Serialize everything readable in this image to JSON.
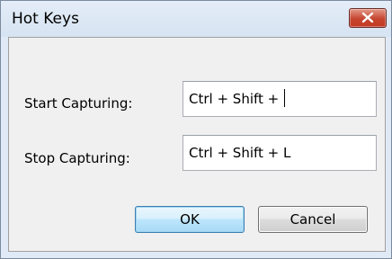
{
  "window": {
    "title": "Hot Keys"
  },
  "form": {
    "start_label": "Start Capturing:",
    "start_value": "Ctrl + Shift + ",
    "stop_label": "Stop Capturing:",
    "stop_value": "Ctrl + Shift + L"
  },
  "buttons": {
    "ok_label": "OK",
    "cancel_label": "Cancel"
  },
  "icons": {
    "close": "close-icon"
  },
  "colors": {
    "close_button": "#c8452f",
    "ok_border": "#3c7fb1",
    "client_background": "#f0f0f0",
    "frame_background": "#dfeaf6"
  }
}
